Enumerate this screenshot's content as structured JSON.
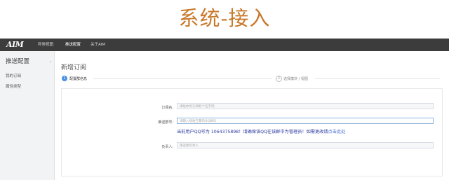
{
  "banner": {
    "title": "系统-接入"
  },
  "navbar": {
    "logo": "AIM",
    "items": [
      {
        "label": "异常视图"
      },
      {
        "label": "推送配置"
      },
      {
        "label": "关于AIM"
      }
    ]
  },
  "sidebar": {
    "title": "推送配置",
    "collapse_icon": "‹",
    "items": [
      {
        "label": "我的订阅"
      },
      {
        "label": "属性类型"
      }
    ]
  },
  "main": {
    "page_title": "新增订阅",
    "steps": [
      {
        "number": "1",
        "label": "配置群信息"
      },
      {
        "number": "2",
        "label": "选择模块 / 视图"
      }
    ],
    "form": {
      "subscription_label": "订阅名:",
      "subscription_placeholder": "请给你的订阅取个名字吧",
      "group_label": "推送群号:",
      "group_placeholder": "请输入接收告警的QQ群号",
      "hint_text": "当前用户QQ号为 1064375898！请确保该QQ在该群中为管理员！如需更改请",
      "hint_link": "点击此处",
      "owner_label": "负责人:",
      "owner_placeholder": "请选择负责人"
    }
  }
}
